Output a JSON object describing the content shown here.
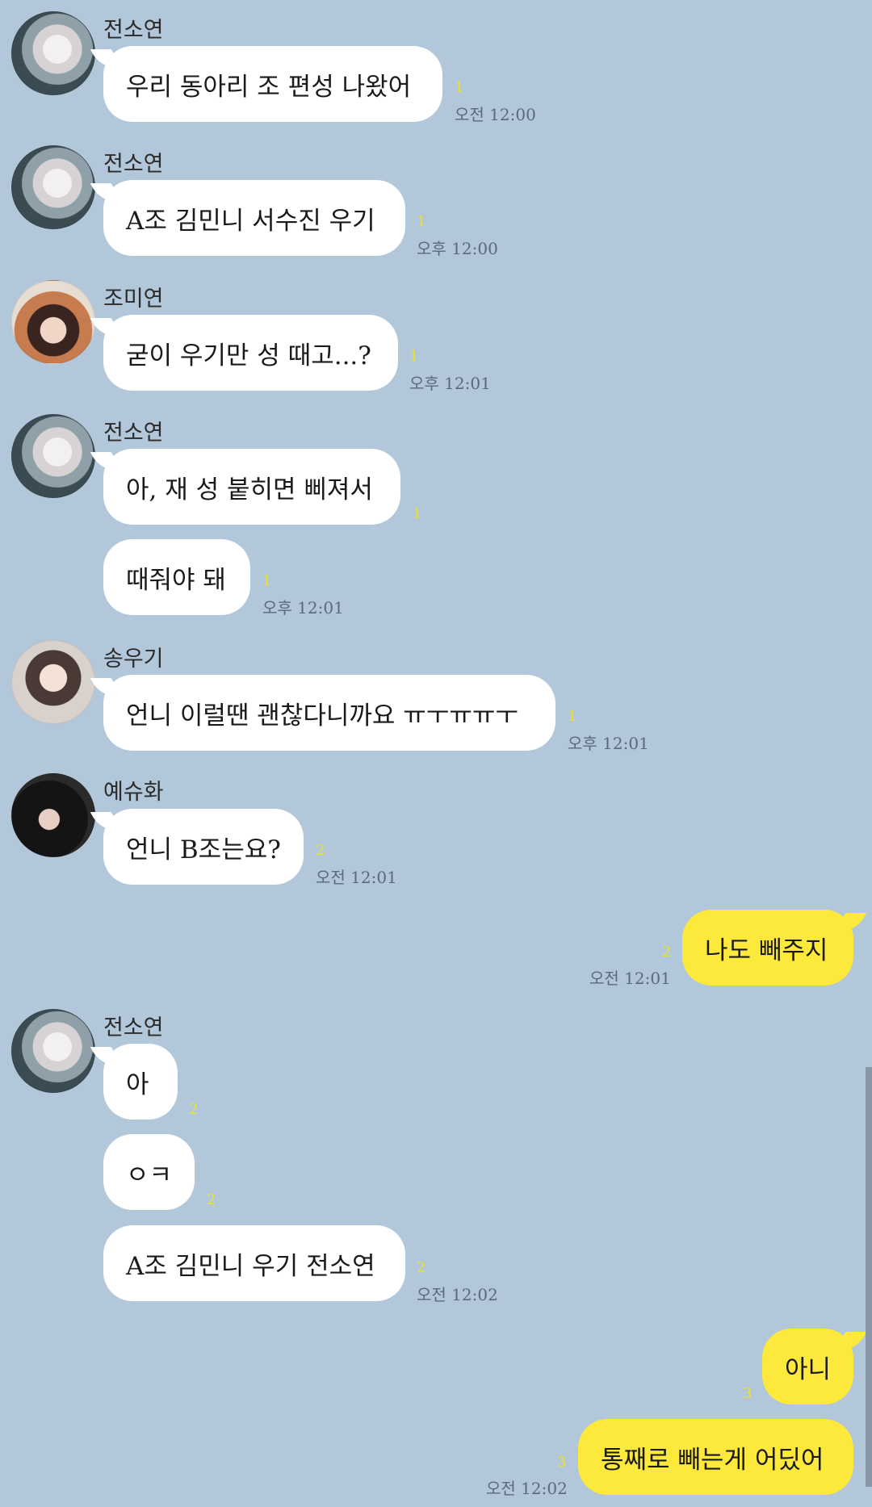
{
  "colors": {
    "background": "#b2c7da",
    "bubble_other": "#ffffff",
    "bubble_mine": "#fde93b",
    "unread": "#e8e22d"
  },
  "messages": [
    {
      "sender": "전소연",
      "text": "우리 동아리 조 편성 나왔어",
      "unread": "1",
      "time": "오전 12:00",
      "avatar": "user-photo-icon"
    },
    {
      "sender": "전소연",
      "text": "A조 김민니 서수진 우기",
      "unread": "1",
      "time": "오후 12:00",
      "avatar": "user-photo-icon"
    },
    {
      "sender": "조미연",
      "text": "굳이 우기만 성 때고...?",
      "unread": "1",
      "time": "오후 12:01",
      "avatar": "user-photo-icon"
    },
    {
      "sender": "전소연",
      "text": "아, 재 성 붙히면 삐져서",
      "unread": "1",
      "time": "",
      "avatar": "user-photo-icon"
    },
    {
      "sender": "",
      "text": "때줘야 돼",
      "unread": "1",
      "time": "오후 12:01"
    },
    {
      "sender": "송우기",
      "text": "언니 이럴땐 괜찮다니까요 ㅠㅜㅠㅠㅜ",
      "unread": "1",
      "time": "오후 12:01",
      "avatar": "user-photo-icon"
    },
    {
      "sender": "예슈화",
      "text": "언니 B조는요?",
      "unread": "2",
      "time": "오전 12:01",
      "avatar": "user-photo-icon"
    },
    {
      "mine": true,
      "text": "나도 빼주지",
      "unread": "2",
      "time": "오전 12:01"
    },
    {
      "sender": "전소연",
      "text": "아",
      "unread": "2",
      "time": "",
      "avatar": "user-photo-icon"
    },
    {
      "sender": "",
      "text": "ㅇㅋ",
      "unread": "2",
      "time": ""
    },
    {
      "sender": "",
      "text": "A조 김민니 우기 전소연",
      "unread": "2",
      "time": "오전 12:02"
    },
    {
      "mine": true,
      "text": "아니",
      "unread": "3",
      "time": ""
    },
    {
      "mine": true,
      "text": "통째로 빼는게 어딨어",
      "unread": "3",
      "time": "오전 12:02"
    }
  ]
}
